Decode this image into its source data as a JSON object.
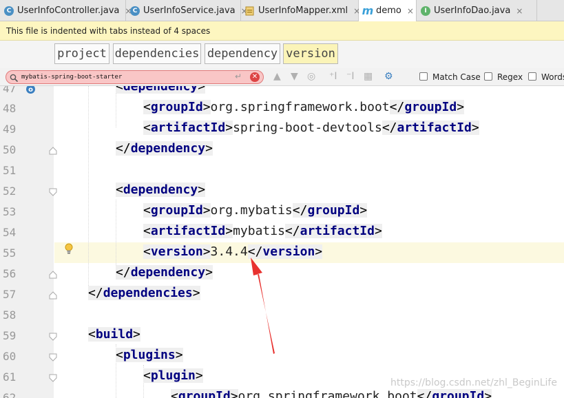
{
  "tabs": [
    {
      "label": "UserInfoController.java",
      "icon": "class-icon",
      "active": false
    },
    {
      "label": "UserInfoService.java",
      "icon": "class-icon",
      "active": false
    },
    {
      "label": "UserInfoMapper.xml",
      "icon": "xml-file-icon",
      "active": false
    },
    {
      "label": "demo",
      "icon": "maven-icon",
      "active": true
    },
    {
      "label": "UserInfoDao.java",
      "icon": "interface-icon",
      "active": false
    }
  ],
  "tab_close_glyph": "×",
  "notice": "This file is indented with tabs instead of 4 spaces",
  "breadcrumb": [
    "project",
    "dependencies",
    "dependency",
    "version"
  ],
  "find": {
    "query": "mybatis-spring-boot-starter",
    "match_case_label": "Match Case",
    "regex_label": "Regex",
    "words_label": "Words"
  },
  "code_lines": [
    {
      "n": "47",
      "text": ""
    },
    {
      "n": "48",
      "text": ""
    },
    {
      "n": "49",
      "text": ""
    },
    {
      "n": "50",
      "text": ""
    },
    {
      "n": "51",
      "text": ""
    },
    {
      "n": "52",
      "text": ""
    },
    {
      "n": "53",
      "text": ""
    },
    {
      "n": "54",
      "text": ""
    },
    {
      "n": "55",
      "text": ""
    },
    {
      "n": "56",
      "text": ""
    },
    {
      "n": "57",
      "text": ""
    },
    {
      "n": "58",
      "text": ""
    },
    {
      "n": "59",
      "text": ""
    },
    {
      "n": "60",
      "text": ""
    },
    {
      "n": "61",
      "text": ""
    },
    {
      "n": "62",
      "text": ""
    }
  ],
  "code": {
    "l47": {
      "tag": "dependency"
    },
    "l48": {
      "open": "groupId",
      "value": "org.springframework.boot",
      "close": "groupId"
    },
    "l49": {
      "open": "artifactId",
      "value": "spring-boot-devtools",
      "close": "artifactId"
    },
    "l50": {
      "tag": "dependency"
    },
    "l52": {
      "tag": "dependency"
    },
    "l53": {
      "open": "groupId",
      "value": "org.mybatis",
      "close": "groupId"
    },
    "l54": {
      "open": "artifactId",
      "value": "mybatis",
      "close": "artifactId"
    },
    "l55": {
      "open": "version",
      "value": "3.4.4",
      "close": "version"
    },
    "l56": {
      "tag": "dependency"
    },
    "l57": {
      "tag": "dependencies"
    },
    "l59": {
      "tag": "build"
    },
    "l60": {
      "tag": "plugins"
    },
    "l61": {
      "tag": "plugin"
    },
    "l62": {
      "open": "groupId",
      "value": "org.springframework.boot",
      "close": "groupId"
    }
  },
  "watermark": "https://blog.csdn.net/zhl_BeginLife",
  "colors": {
    "tag": "#000080",
    "annotation_arrow": "#e8322f",
    "search_error": "#f9c6c6",
    "notice": "#fdf6c0"
  }
}
